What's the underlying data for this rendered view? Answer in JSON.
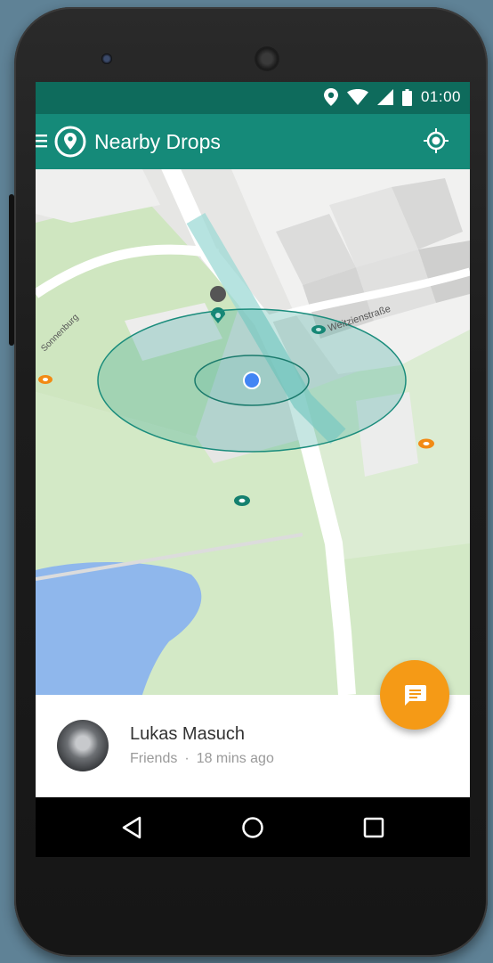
{
  "status_bar": {
    "time": "01:00",
    "icons": [
      "location-icon",
      "wifi-icon",
      "signal-icon",
      "battery-icon"
    ]
  },
  "app_bar": {
    "title": "Nearby Drops",
    "menu_icon": "hamburger-menu-icon",
    "logo_icon": "map-pin-icon",
    "action_icon": "my-location-icon"
  },
  "map": {
    "street_labels": [
      "Weitzienstraße",
      "Sonnenburg"
    ]
  },
  "drop_card": {
    "name": "Lukas Masuch",
    "audience": "Friends",
    "separator": "·",
    "time_ago": "18 mins ago"
  },
  "fab": {
    "icon": "message-icon"
  },
  "nav_bar": {
    "icons": [
      "back-icon",
      "home-icon",
      "recents-icon"
    ]
  },
  "colors": {
    "status_bar": "#0e6b5c",
    "app_bar": "#158a79",
    "fab": "#f59a16",
    "my_location": "#4285f4",
    "drop_teal": "#14806f",
    "drop_orange": "#f28a14"
  }
}
